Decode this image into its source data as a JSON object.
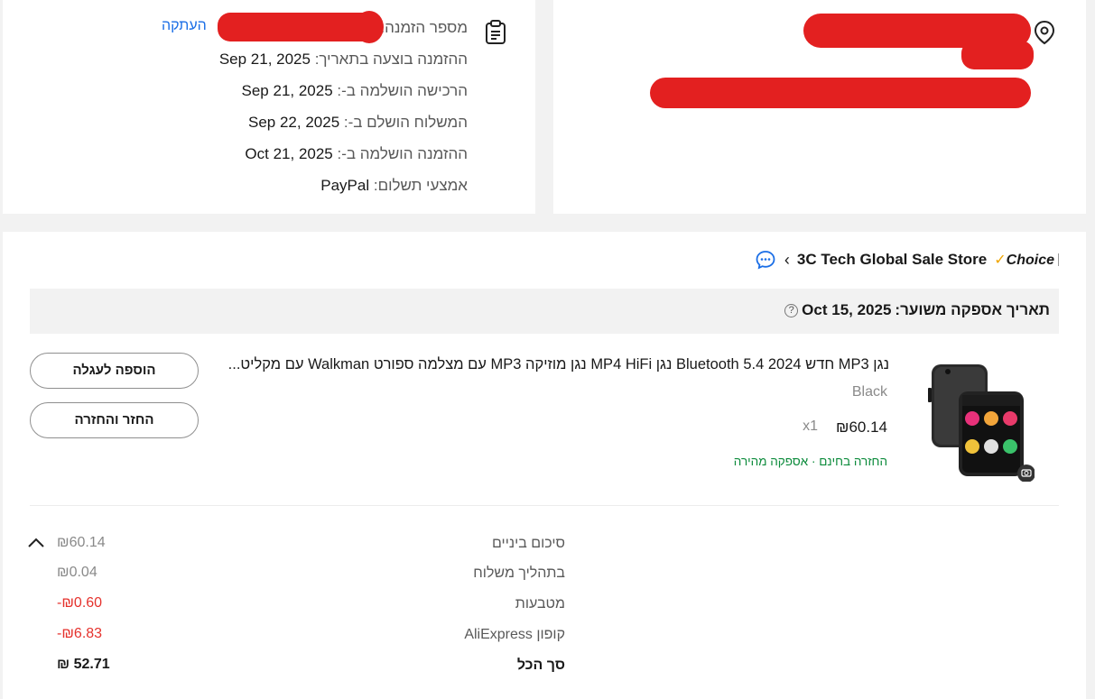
{
  "order": {
    "order_number_label": "מספר הזמנה:",
    "copy_label": "העתקה",
    "rows": [
      {
        "label": "ההזמנה בוצעה בתאריך:",
        "value": "Sep 21, 2025"
      },
      {
        "label": "הרכישה הושלמה ב-:",
        "value": "Sep 21, 2025"
      },
      {
        "label": "המשלוח הושלם ב-:",
        "value": "Sep 22, 2025"
      },
      {
        "label": "ההזמנה הושלמה ב-:",
        "value": "Oct 21, 2025"
      },
      {
        "label": "אמצעי תשלום:",
        "value": "PayPal"
      }
    ]
  },
  "store": {
    "badge": "Choice",
    "name": "3C Tech Global Sale Store"
  },
  "delivery": {
    "label": "תאריך אספקה משוער:",
    "date": "Oct 15, 2025"
  },
  "product": {
    "title": "נגן MP3 חדש Bluetooth 5.4 2024 נגן MP4 HiFi נגן מוזיקה MP3 עם מצלמה ספורט Walkman עם מקליט...",
    "variant": "Black",
    "price": "₪60.14",
    "qty": "x1",
    "tags": "החזרה בחינם · אספקה מהירה"
  },
  "actions": {
    "add_to_cart": "הוספה לעגלה",
    "return_refund": "החזר והחזרה"
  },
  "summary": [
    {
      "label": "סיכום ביניים",
      "value": "₪60.14"
    },
    {
      "label": "בתהליך משלוח",
      "value": "₪0.04"
    },
    {
      "label": "מטבעות",
      "value": "-₪0.60"
    },
    {
      "label": "קופון AliExpress",
      "value": "-₪6.83"
    },
    {
      "label": "סך הכל",
      "value": "₪ 52.71"
    }
  ],
  "colors": {
    "link": "#1a6ee6",
    "discount": "#e5322d",
    "tag_green": "#0a8a3a",
    "redaction": "#e32020"
  }
}
